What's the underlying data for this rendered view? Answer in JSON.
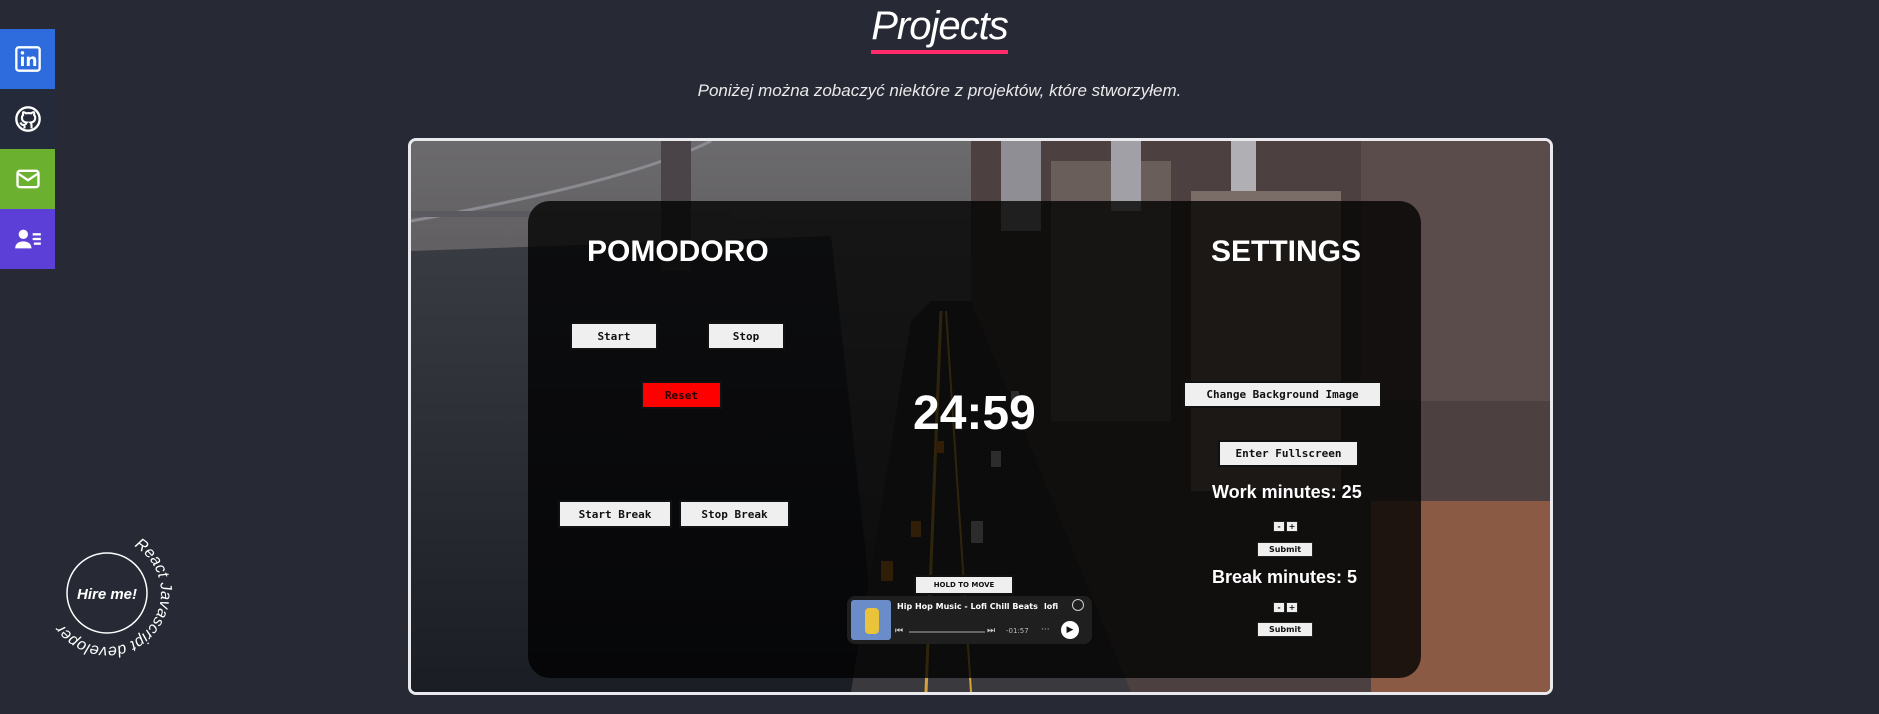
{
  "social": [
    {
      "name": "linkedin",
      "icon": "linkedin-icon",
      "color": "#2e6bdc"
    },
    {
      "name": "github",
      "icon": "github-icon",
      "color": "#252a3a"
    },
    {
      "name": "email",
      "icon": "mail-icon",
      "color": "#6bb02e"
    },
    {
      "name": "contact",
      "icon": "contact-card-icon",
      "color": "#5b3fd6"
    }
  ],
  "header": {
    "title": "Projects",
    "subtitle": "Poniżej można zobaczyć niektóre z projektów, które stworzyłem."
  },
  "colors": {
    "accent": "#ff2b6b",
    "background": "#272a35"
  },
  "project": {
    "pomodoro_title": "POMODORO",
    "settings_title": "SETTINGS",
    "timer": "24:59",
    "buttons": {
      "start": "Start",
      "stop": "Stop",
      "reset": "Reset",
      "start_break": "Start Break",
      "stop_break": "Stop Break",
      "change_bg": "Change Background Image",
      "fullscreen": "Enter Fullscreen"
    },
    "work_minutes": "Work minutes: 25",
    "break_minutes": "Break minutes: 5",
    "minus": "-",
    "plus": "+",
    "submit": "Submit",
    "hold_to_move": "HOLD TO MOVE",
    "player": {
      "track": "Hip Hop Music - Lofi Chill Beats",
      "track_tail": "lofi",
      "time": "-01:57",
      "more": "···"
    }
  },
  "hire": {
    "label": "Hire me!",
    "ring_text": "React Javascript developer"
  }
}
